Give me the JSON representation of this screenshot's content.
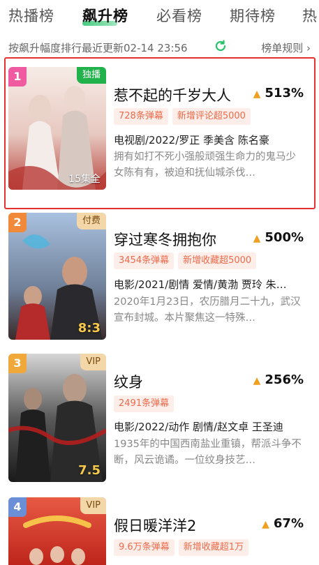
{
  "tabs": [
    {
      "label": "热播榜",
      "active": false
    },
    {
      "label": "飙升榜",
      "active": true
    },
    {
      "label": "必看榜",
      "active": false
    },
    {
      "label": "期待榜",
      "active": false
    },
    {
      "label": "热",
      "active": false
    }
  ],
  "info": {
    "update_text": "按飙升幅度排行最近更新02-14 23:56",
    "rules_label": "榜单规则 ›"
  },
  "items": [
    {
      "rank": "1",
      "rank_color": "#f05aa0",
      "badge": "独播",
      "badge_type": "excl",
      "corner": "15集全",
      "corner_type": "ep",
      "title": "惹不起的千岁大人",
      "heat": "513%",
      "tags": [
        "728条弹幕",
        "新增评论超5000"
      ],
      "meta": "电视剧/2022/罗正 季美含 陈名豪",
      "desc": "拥有如打不死小强般顽强生命力的鬼马少女陈有有，被迫和抚仙城杀伐…",
      "poster_colors": [
        "#f3e3dc",
        "#d9b3a8",
        "#b33a36"
      ]
    },
    {
      "rank": "2",
      "rank_color": "#f08a3a",
      "badge": "付费",
      "badge_type": "paid",
      "corner": "8:3",
      "corner_type": "score",
      "title": "穿过寒冬拥抱你",
      "heat": "500%",
      "tags": [
        "3454条弹幕",
        "新增收藏超5000"
      ],
      "meta": "电影/2021/剧情 爱情/黄渤 贾玲 朱…",
      "desc": "2020年1月23日，农历腊月二十九，武汉宣布封城。本片聚焦这一特殊…",
      "poster_colors": [
        "#9fb7d6",
        "#5f6f8a",
        "#7a2a2a"
      ]
    },
    {
      "rank": "3",
      "rank_color": "#f0a83a",
      "badge": "VIP",
      "badge_type": "vip",
      "corner": "7.5",
      "corner_type": "score",
      "title": "纹身",
      "heat": "256%",
      "tags": [
        "2491条弹幕"
      ],
      "meta": "电影/2022/动作 剧情/赵文卓 王圣迪",
      "desc": "1935年的中国西南盐业重镇，帮派斗争不断，风云诡谲。一位纹身技艺…",
      "poster_colors": [
        "#cfcfcf",
        "#3a3a3a",
        "#8a1a1a"
      ]
    },
    {
      "rank": "4",
      "rank_color": "#6a8fd6",
      "badge": "VIP",
      "badge_type": "vip",
      "corner": "",
      "corner_type": "ep",
      "title": "假日暖洋洋2",
      "heat": "67%",
      "tags": [
        "9.6万条弹幕",
        "新增收藏超1万"
      ],
      "meta": "",
      "desc": "",
      "poster_colors": [
        "#e04a3a",
        "#c8281e",
        "#f5c04a"
      ]
    }
  ],
  "accent_color": "#27c26a",
  "highlight_color": "#e8302f"
}
